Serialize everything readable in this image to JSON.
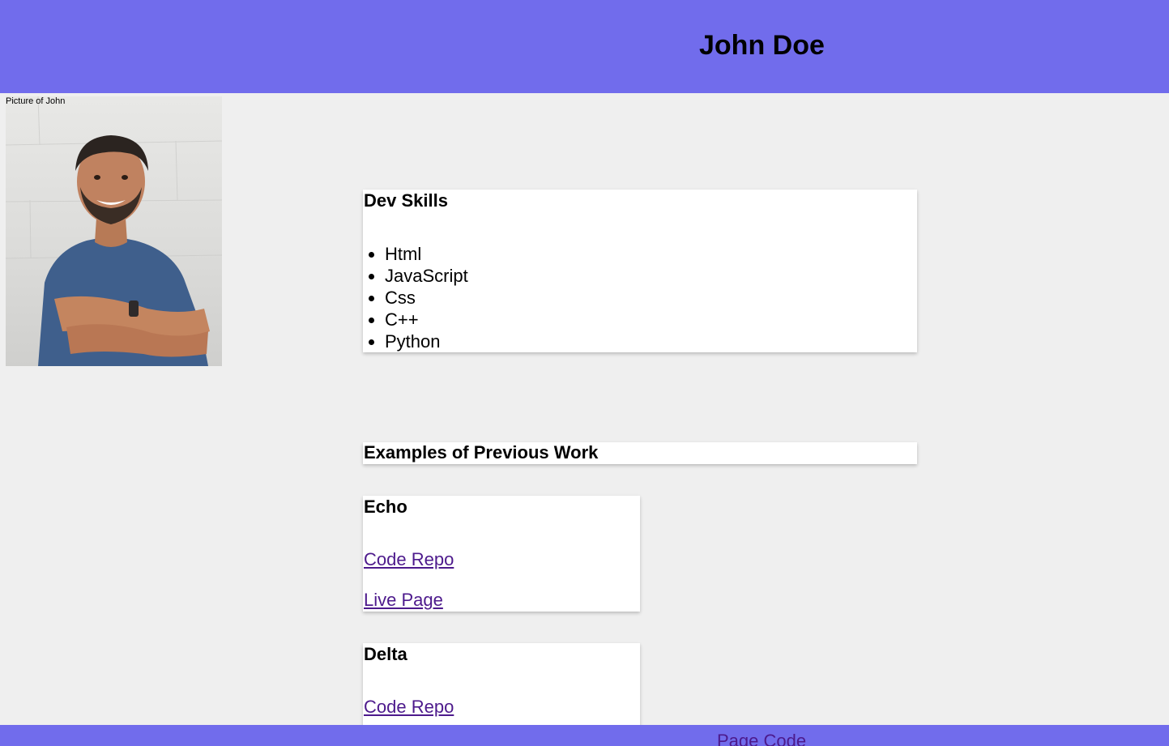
{
  "header": {
    "title": "John Doe"
  },
  "photo": {
    "alt_text": "Picture of John"
  },
  "skills": {
    "title": "Dev Skills",
    "items": [
      "Html",
      "JavaScript",
      "Css",
      "C++",
      "Python"
    ]
  },
  "work": {
    "title": "Examples of Previous Work",
    "projects": [
      {
        "name": "Echo",
        "repo_label": "Code Repo",
        "live_label": "Live Page"
      },
      {
        "name": "Delta",
        "repo_label": "Code Repo"
      }
    ]
  },
  "footer": {
    "link_label": "Page Code"
  },
  "colors": {
    "header_bg": "#716cec",
    "page_bg": "#efefef",
    "link": "#4d1a8c"
  }
}
